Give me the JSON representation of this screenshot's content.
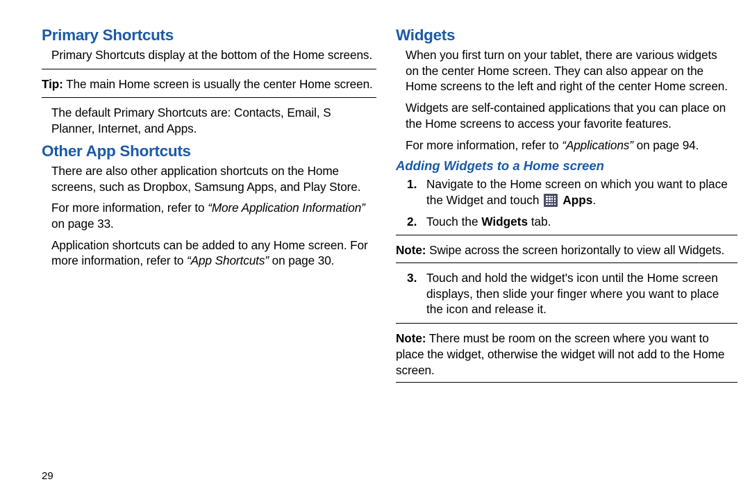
{
  "page_number": "29",
  "left": {
    "section1_title": "Primary Shortcuts",
    "section1_p1": "Primary Shortcuts display at the bottom of the Home screens.",
    "tip_label": "Tip:",
    "tip_text": " The main Home screen is usually the center Home screen.",
    "section1_p2": "The default Primary Shortcuts are: Contacts, Email, S Planner,  Internet, and Apps.",
    "section2_title": "Other App Shortcuts",
    "section2_p1": "There are also other application shortcuts on the Home screens, such as Dropbox, Samsung Apps, and Play Store.",
    "section2_p2_a": "For more information, refer to ",
    "section2_p2_ref": "“More Application Information”",
    "section2_p2_b": " on page 33.",
    "section2_p3_a": "Application shortcuts can be added to any Home screen. For more information, refer to ",
    "section2_p3_ref": "“App Shortcuts”",
    "section2_p3_b": " on page 30."
  },
  "right": {
    "section_title": "Widgets",
    "p1": "When you first turn on your tablet, there are various widgets on the center Home screen. They can also appear on the Home screens to the left and right of the center Home screen.",
    "p2": "Widgets are self-contained applications that you can place on the Home screens to access your favorite features.",
    "p3_a": "For more information, refer to ",
    "p3_ref": "“Applications”",
    "p3_b": " on page 94.",
    "sub_title": "Adding Widgets to a Home screen",
    "step1_a": "Navigate to the Home screen on which you want to place the Widget and touch ",
    "step1_apps": " Apps",
    "step1_end": ".",
    "step2_a": "Touch the ",
    "step2_b": "Widgets",
    "step2_c": " tab.",
    "note1_label": "Note:",
    "note1_text": " Swipe across the screen horizontally to view all Widgets.",
    "step3": "Touch and hold the widget's icon until the Home screen displays, then slide your finger where you want to place the icon and release it.",
    "note2_label": "Note:",
    "note2_text": " There must be room on the screen where you want to place the widget, otherwise the widget will not add to the Home screen."
  }
}
